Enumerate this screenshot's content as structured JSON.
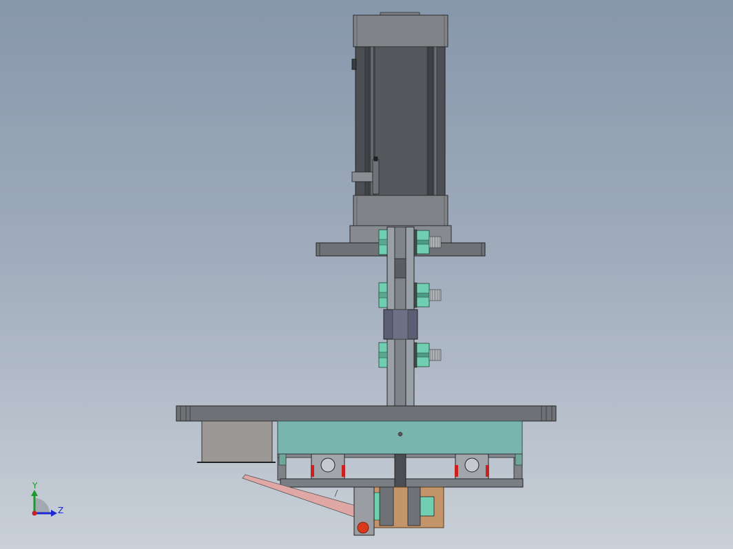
{
  "triad": {
    "y_label": "Y",
    "z_label": "Z",
    "y_color": "#1a9a2a",
    "z_color": "#1a2ad0",
    "origin_color": "#c8202a"
  },
  "colors": {
    "background_top": "#8797ab",
    "background_bottom": "#c9d0d8",
    "motor_body": "#4a4e53",
    "steel": "#8c9096",
    "steel_dark": "#5a5e63",
    "nut": "#6fcfb0",
    "housing": "#79b4ae",
    "handle": "#e0a8a4",
    "copper_plate": "#c4946a",
    "knob": "#d9381a",
    "bearing_seal": "#cc2020"
  },
  "icons": {
    "triad": "coordinate-triad-icon"
  }
}
